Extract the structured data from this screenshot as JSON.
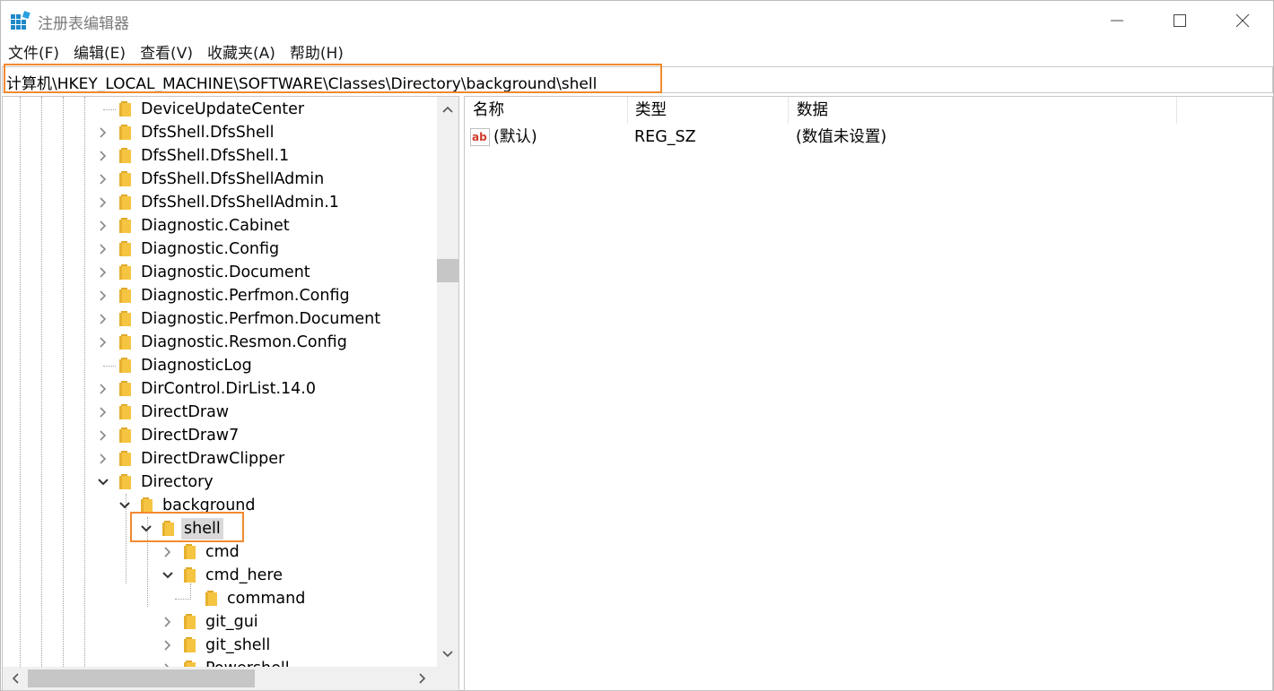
{
  "window": {
    "title": "注册表编辑器",
    "controls": {
      "minimize": "minimize",
      "maximize": "maximize",
      "close": "close"
    }
  },
  "menu": [
    "文件(F)",
    "编辑(E)",
    "查看(V)",
    "收藏夹(A)",
    "帮助(H)"
  ],
  "address": "计算机\\HKEY_LOCAL_MACHINE\\SOFTWARE\\Classes\\Directory\\background\\shell",
  "tree": {
    "items": [
      {
        "label": "DeviceUpdateCenter",
        "level": 0,
        "expander": "none"
      },
      {
        "label": "DfsShell.DfsShell",
        "level": 0,
        "expander": "collapsed"
      },
      {
        "label": "DfsShell.DfsShell.1",
        "level": 0,
        "expander": "collapsed"
      },
      {
        "label": "DfsShell.DfsShellAdmin",
        "level": 0,
        "expander": "collapsed"
      },
      {
        "label": "DfsShell.DfsShellAdmin.1",
        "level": 0,
        "expander": "collapsed"
      },
      {
        "label": "Diagnostic.Cabinet",
        "level": 0,
        "expander": "collapsed"
      },
      {
        "label": "Diagnostic.Config",
        "level": 0,
        "expander": "collapsed"
      },
      {
        "label": "Diagnostic.Document",
        "level": 0,
        "expander": "collapsed"
      },
      {
        "label": "Diagnostic.Perfmon.Config",
        "level": 0,
        "expander": "collapsed"
      },
      {
        "label": "Diagnostic.Perfmon.Document",
        "level": 0,
        "expander": "collapsed"
      },
      {
        "label": "Diagnostic.Resmon.Config",
        "level": 0,
        "expander": "collapsed"
      },
      {
        "label": "DiagnosticLog",
        "level": 0,
        "expander": "none"
      },
      {
        "label": "DirControl.DirList.14.0",
        "level": 0,
        "expander": "collapsed"
      },
      {
        "label": "DirectDraw",
        "level": 0,
        "expander": "collapsed"
      },
      {
        "label": "DirectDraw7",
        "level": 0,
        "expander": "collapsed"
      },
      {
        "label": "DirectDrawClipper",
        "level": 0,
        "expander": "collapsed"
      },
      {
        "label": "Directory",
        "level": 0,
        "expander": "expanded"
      },
      {
        "label": "background",
        "level": 1,
        "expander": "expanded"
      },
      {
        "label": "shell",
        "level": 2,
        "expander": "expanded",
        "selected": true
      },
      {
        "label": "cmd",
        "level": 3,
        "expander": "collapsed"
      },
      {
        "label": "cmd_here",
        "level": 3,
        "expander": "expanded"
      },
      {
        "label": "command",
        "level": 4,
        "expander": "none"
      },
      {
        "label": "git_gui",
        "level": 3,
        "expander": "collapsed"
      },
      {
        "label": "git_shell",
        "level": 3,
        "expander": "collapsed"
      },
      {
        "label": "Powershell",
        "level": 3,
        "expander": "collapsed"
      }
    ]
  },
  "list": {
    "columns": [
      "名称",
      "类型",
      "数据"
    ],
    "rows": [
      {
        "name": "(默认)",
        "type": "REG_SZ",
        "data": "(数值未设置)",
        "icon": "string-value-icon"
      }
    ]
  },
  "colors": {
    "highlight": "#f08a30",
    "folder": "#f5c542",
    "selected_bg": "#d9d9d9"
  }
}
